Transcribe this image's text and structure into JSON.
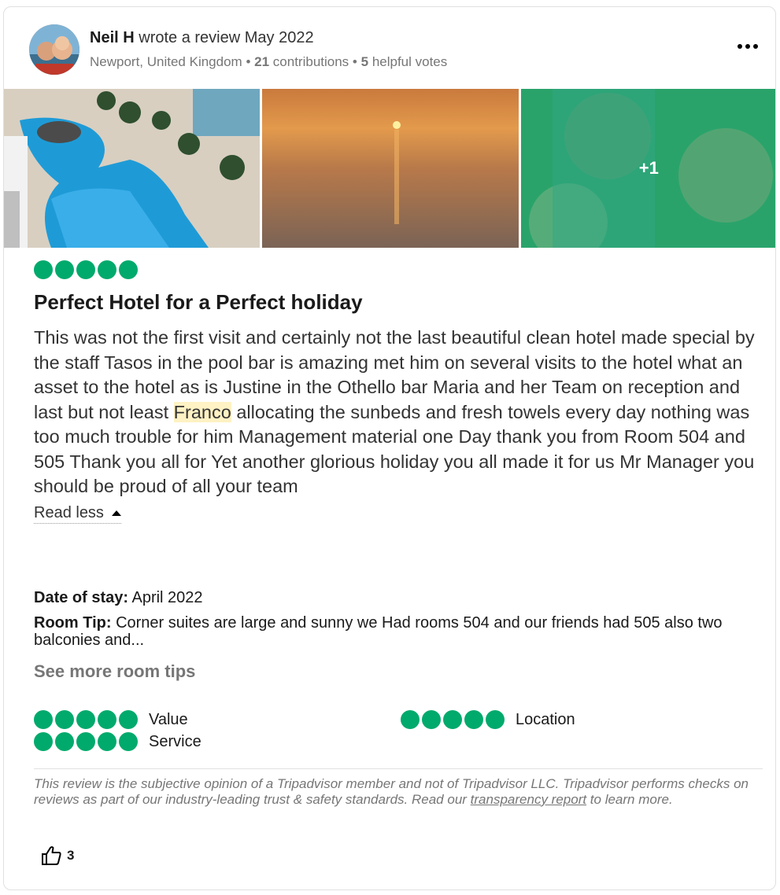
{
  "review": {
    "author": "Neil H",
    "action": "wrote a review May 2022",
    "location": "Newport, United Kingdom",
    "sep": "•",
    "contributions_count": "21",
    "contributions_label": "contributions",
    "helpful_count": "5",
    "helpful_label": "helpful votes",
    "more_label": "More options",
    "photos_more": "+1",
    "rating": 5,
    "title": "Perfect Hotel for a Perfect holiday",
    "body_before": "This was not the first visit and certainly not the last beautiful clean hotel made special by the staff Tasos in the pool bar is amazing met him on several visits to the hotel what an asset to the hotel as is Justine in the Othello bar Maria and her Team on reception and last but not least ",
    "body_highlight": "Franco",
    "body_after": " allocating the sunbeds and fresh towels every day nothing was too much trouble for him Management material one Day thank you from Room 504 and 505 Thank you all for Yet another glorious holiday you all made it for us Mr Manager you should be proud of all your team",
    "read_less": "Read less",
    "date_of_stay_label": "Date of stay:",
    "date_of_stay": "April 2022",
    "room_tip_label": "Room Tip:",
    "room_tip": "Corner suites are large and sunny we Had rooms 504 and our friends had 505 also two balconies and...",
    "see_more_tips": "See more room tips",
    "subratings": [
      {
        "label": "Value",
        "rating": 5
      },
      {
        "label": "Location",
        "rating": 5
      },
      {
        "label": "Service",
        "rating": 5
      }
    ],
    "disclaimer_before": "This review is the subjective opinion of a Tripadvisor member and not of Tripadvisor LLC. Tripadvisor performs checks on reviews as part of our industry-leading trust & safety standards. Read our ",
    "disclaimer_link": "transparency report",
    "disclaimer_after": " to learn more.",
    "upvotes": "3"
  },
  "colors": {
    "bubble": "#00aa6c",
    "highlight": "#fff2c4",
    "muted": "#767676"
  },
  "icons": {
    "more": "three-dots-icon",
    "caret": "caret-up-icon",
    "thumb": "thumbs-up-icon"
  }
}
